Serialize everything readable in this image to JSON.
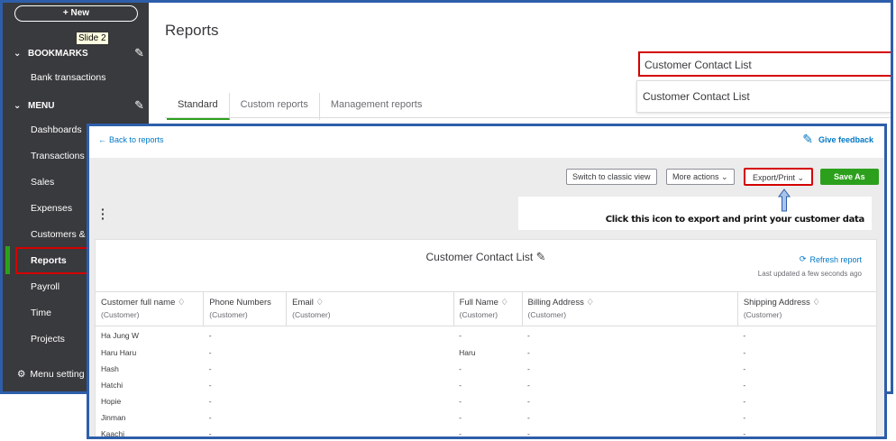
{
  "sidebar": {
    "new_label": "+  New",
    "tooltip": "Slide 2",
    "bookmarks_label": "BOOKMARKS",
    "bookmark_items": [
      "Bank transactions"
    ],
    "menu_label": "MENU",
    "menu_items": [
      "Dashboards",
      "Transactions",
      "Sales",
      "Expenses",
      "Customers & l",
      "Reports",
      "Payroll",
      "Time",
      "Projects"
    ],
    "active_item": "Reports",
    "settings_label": "Menu setting"
  },
  "main": {
    "title": "Reports",
    "tabs": [
      "Standard",
      "Custom reports",
      "Management reports"
    ],
    "active_tab": "Standard",
    "search_value": "Customer Contact List",
    "search_suggestion": "Customer Contact List"
  },
  "report_window": {
    "back_label": "Back to reports",
    "feedback_label": "Give feedback",
    "buttons": {
      "classic": "Switch to classic view",
      "more": "More actions",
      "export": "Export/Print",
      "save": "Save As"
    },
    "callout_text": "Click this icon to export and print your customer data",
    "report_title": "Customer Contact List",
    "refresh_label": "Refresh report",
    "updated_label": "Last updated a few seconds ago",
    "columns": [
      {
        "name": "Customer full name",
        "sub": "(Customer)",
        "sortable": true
      },
      {
        "name": "Phone Numbers",
        "sub": "(Customer)",
        "sortable": false
      },
      {
        "name": "Email",
        "sub": "(Customer)",
        "sortable": true
      },
      {
        "name": "Full Name",
        "sub": "(Customer)",
        "sortable": true
      },
      {
        "name": "Billing Address",
        "sub": "(Customer)",
        "sortable": true
      },
      {
        "name": "Shipping Address",
        "sub": "(Customer)",
        "sortable": true
      }
    ],
    "rows": [
      [
        "Ha Jung W",
        "-",
        "",
        "-",
        "-",
        "-"
      ],
      [
        "Haru Haru",
        "-",
        "",
        "Haru",
        "-",
        "-"
      ],
      [
        "Hash",
        "-",
        "",
        "-",
        "-",
        "-"
      ],
      [
        "Hatchi",
        "-",
        "",
        "-",
        "-",
        "-"
      ],
      [
        "Hopie",
        "-",
        "",
        "-",
        "-",
        "-"
      ],
      [
        "Jinman",
        "-",
        "",
        "-",
        "-",
        "-"
      ],
      [
        "Kaachi",
        "-",
        "",
        "-",
        "-",
        "-"
      ]
    ]
  },
  "colors": {
    "sidebar_bg": "#393a3d",
    "accent_green": "#2ca01c",
    "link_blue": "#0077c5",
    "highlight_red": "#d40000",
    "frame_blue": "#2e5eaa"
  }
}
